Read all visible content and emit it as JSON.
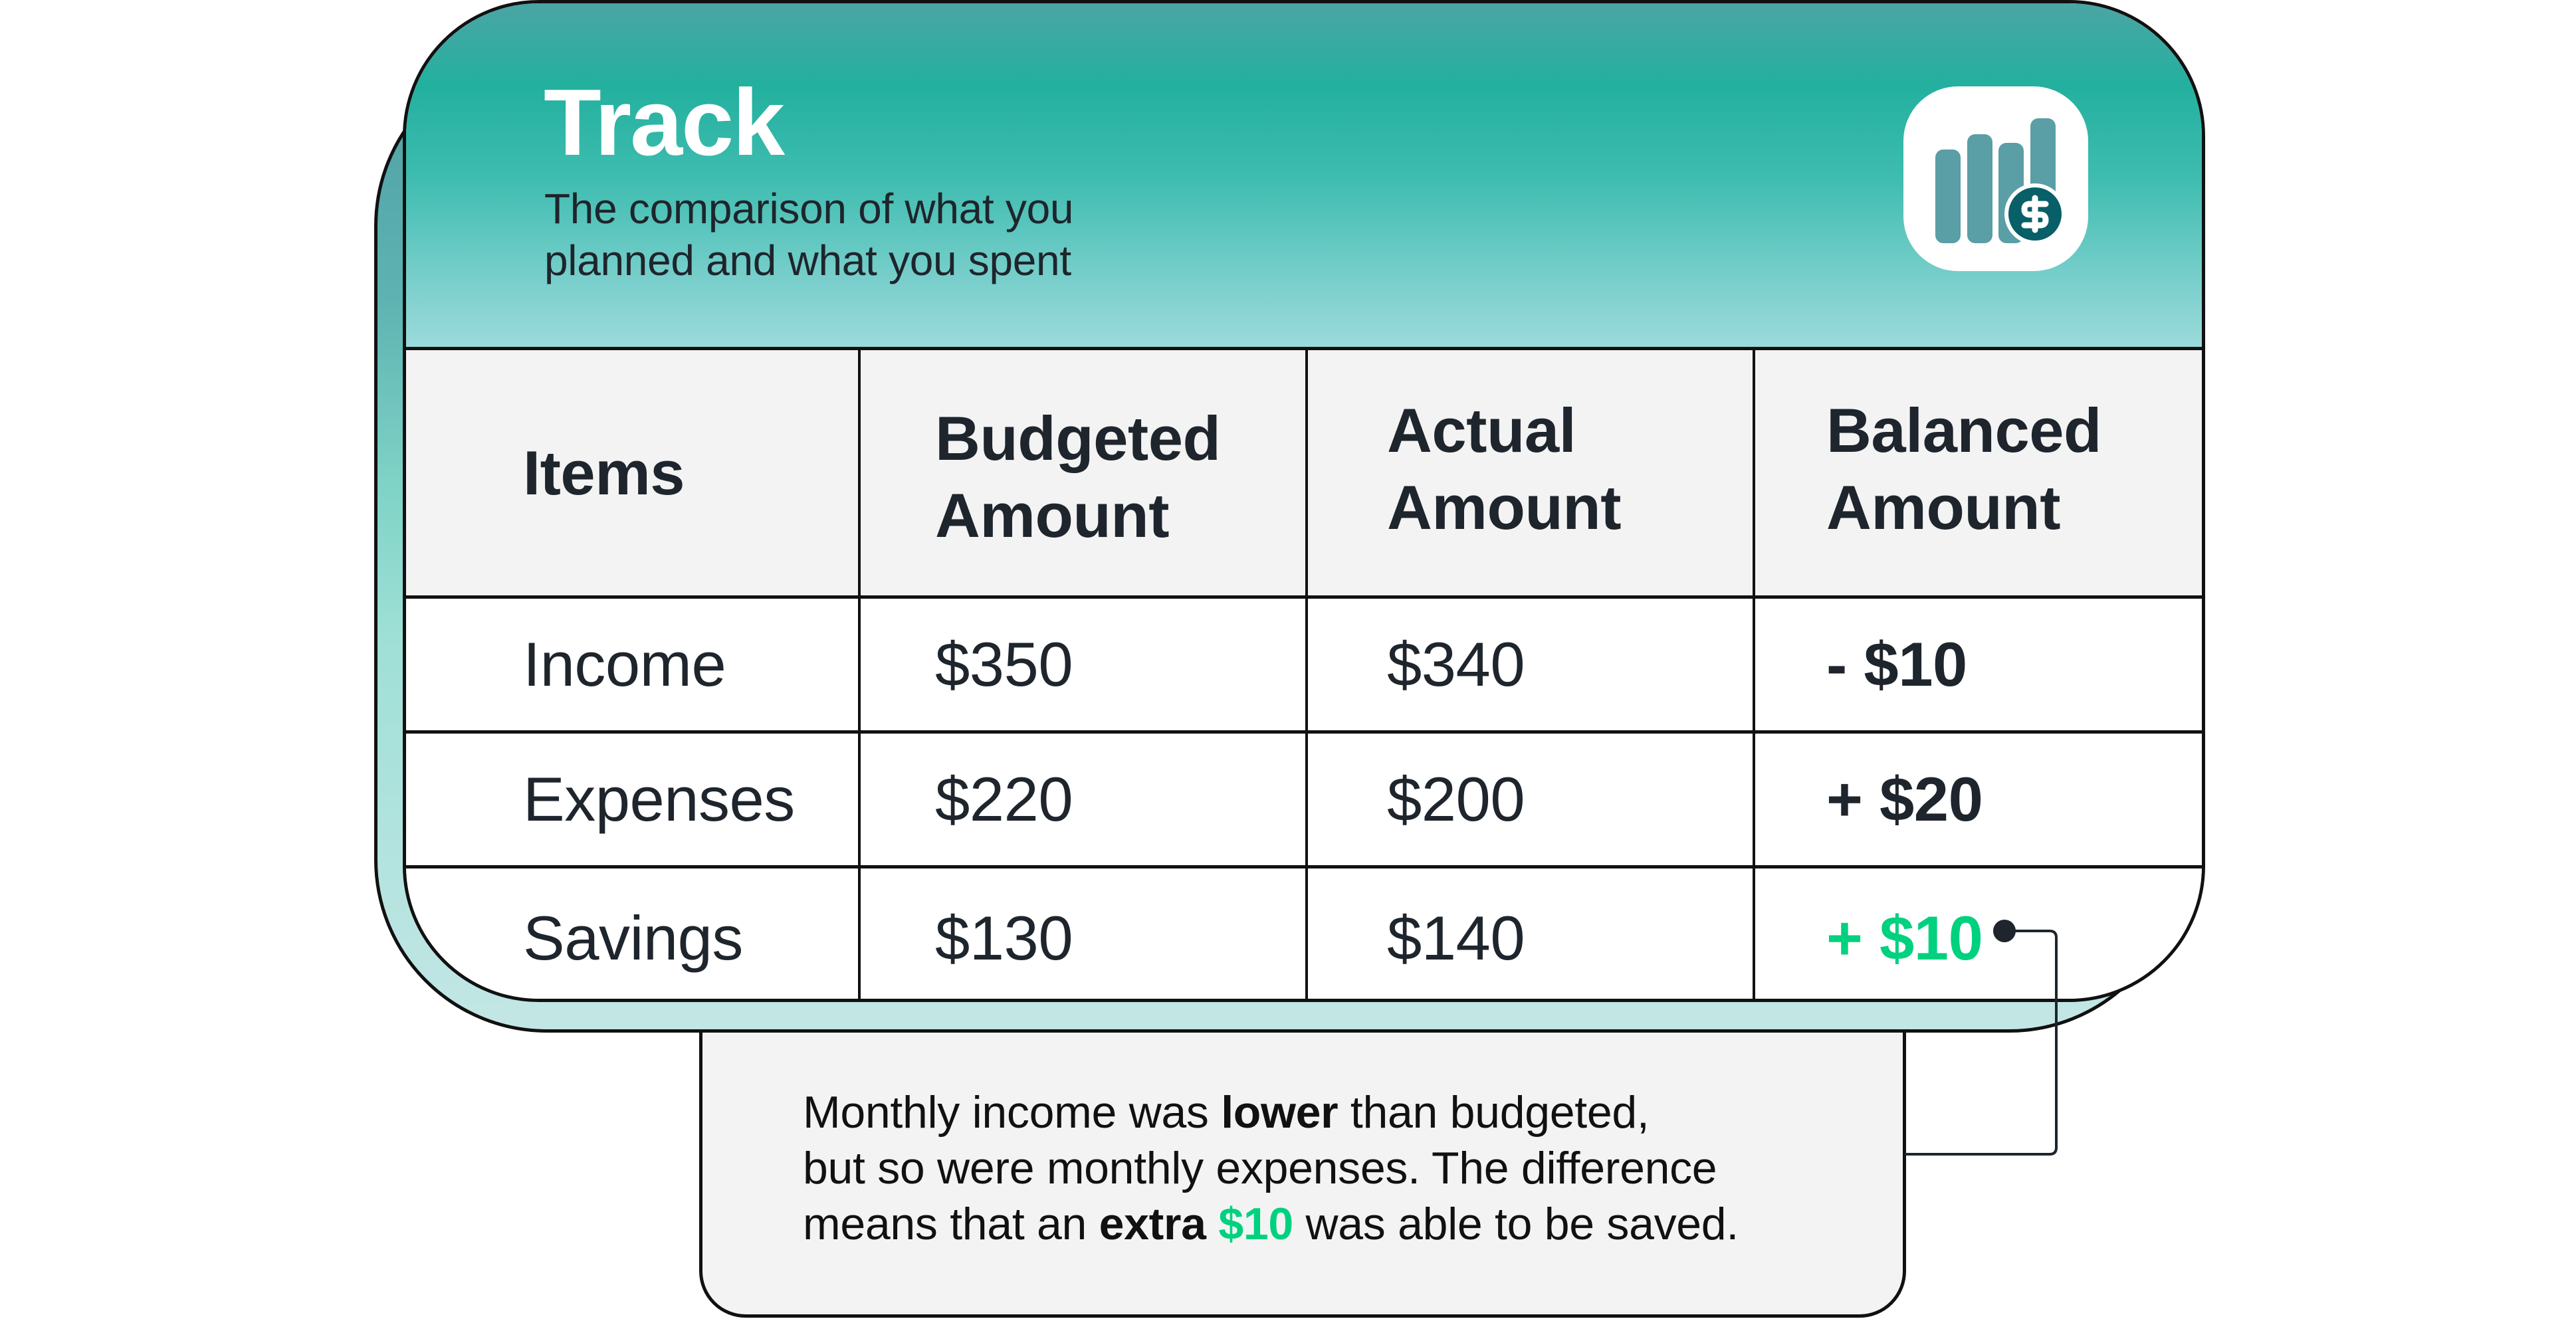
{
  "card": {
    "title": "Track",
    "subtitle": "The comparison of what you\nplanned and what you spent",
    "icon": "bar-chart-dollar-icon"
  },
  "colors": {
    "accent_green": "#00d17f",
    "header_teal": "#23b09e",
    "text_dark": "#1e252c",
    "icon_bars": "#5a9ea6",
    "icon_coin": "#085f68"
  },
  "table": {
    "headers": [
      "Items",
      "Budgeted\nAmount",
      "Actual\nAmount",
      "Balanced\nAmount"
    ],
    "rows": [
      {
        "item": "Income",
        "budgeted": "$350",
        "actual": "$340",
        "balanced": "- $10"
      },
      {
        "item": "Expenses",
        "budgeted": "$220",
        "actual": "$200",
        "balanced": "+ $20"
      },
      {
        "item": "Savings",
        "budgeted": "$130",
        "actual": "$140",
        "balanced": "+ $10"
      }
    ]
  },
  "callout": {
    "line1_pre": "Monthly income was ",
    "line1_bold": "lower",
    "line1_post": " than budgeted,",
    "line2": "but so were monthly expenses. The difference",
    "line3_pre": "means that an ",
    "line3_bold": "extra",
    "line3_space": " ",
    "line3_green": "$10",
    "line3_post": " was able to be saved."
  }
}
